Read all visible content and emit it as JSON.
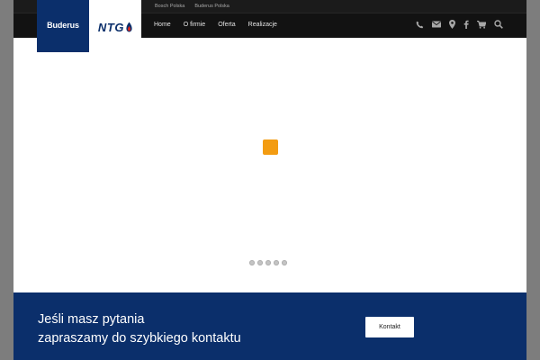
{
  "top_links": [
    "Bosch Polska",
    "Buderus Polska"
  ],
  "logo": {
    "brand": "Buderus",
    "partner": "NTG"
  },
  "nav": {
    "items": [
      "Home",
      "O firmie",
      "Oferta",
      "Realizacje"
    ],
    "icons": [
      "phone-icon",
      "envelope-icon",
      "map-marker-icon",
      "facebook-icon",
      "cart-icon",
      "search-icon"
    ]
  },
  "slider": {
    "dot_count": 5,
    "loader_color": "#f39c12"
  },
  "cta": {
    "line1": "Jeśli masz pytania",
    "line2": "zapraszamy do szybkiego kontaktu",
    "button": "Kontakt"
  },
  "colors": {
    "brand_blue": "#0b2f6b",
    "topbar": "#121212",
    "accent": "#f39c12",
    "flame": "#e2231a"
  }
}
